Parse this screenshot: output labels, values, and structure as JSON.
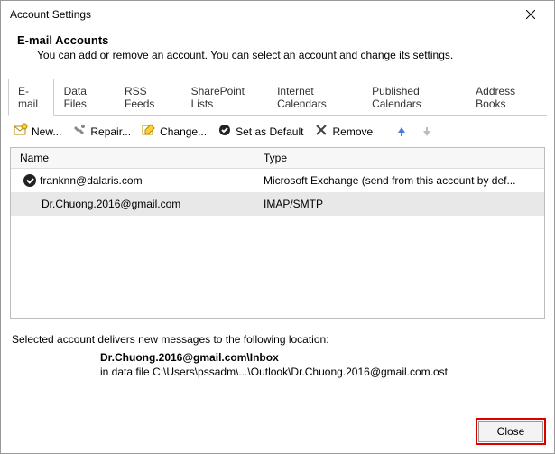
{
  "window": {
    "title": "Account Settings"
  },
  "header": {
    "title": "E-mail Accounts",
    "subtitle": "You can add or remove an account. You can select an account and change its settings."
  },
  "tabs": [
    {
      "label": "E-mail",
      "active": true
    },
    {
      "label": "Data Files"
    },
    {
      "label": "RSS Feeds"
    },
    {
      "label": "SharePoint Lists"
    },
    {
      "label": "Internet Calendars"
    },
    {
      "label": "Published Calendars"
    },
    {
      "label": "Address Books"
    }
  ],
  "toolbar": {
    "new": "New...",
    "repair": "Repair...",
    "change": "Change...",
    "default": "Set as Default",
    "remove": "Remove"
  },
  "list": {
    "columns": {
      "name": "Name",
      "type": "Type"
    },
    "rows": [
      {
        "name": "franknn@dalaris.com",
        "type": "Microsoft Exchange (send from this account by def...",
        "default": true,
        "selected": false
      },
      {
        "name": "Dr.Chuong.2016@gmail.com",
        "type": "IMAP/SMTP",
        "default": false,
        "selected": true
      }
    ]
  },
  "delivery": {
    "intro": "Selected account delivers new messages to the following location:",
    "location_bold": "Dr.Chuong.2016@gmail.com\\Inbox",
    "location_path": "in data file C:\\Users\\pssadm\\...\\Outlook\\Dr.Chuong.2016@gmail.com.ost"
  },
  "footer": {
    "close": "Close"
  }
}
